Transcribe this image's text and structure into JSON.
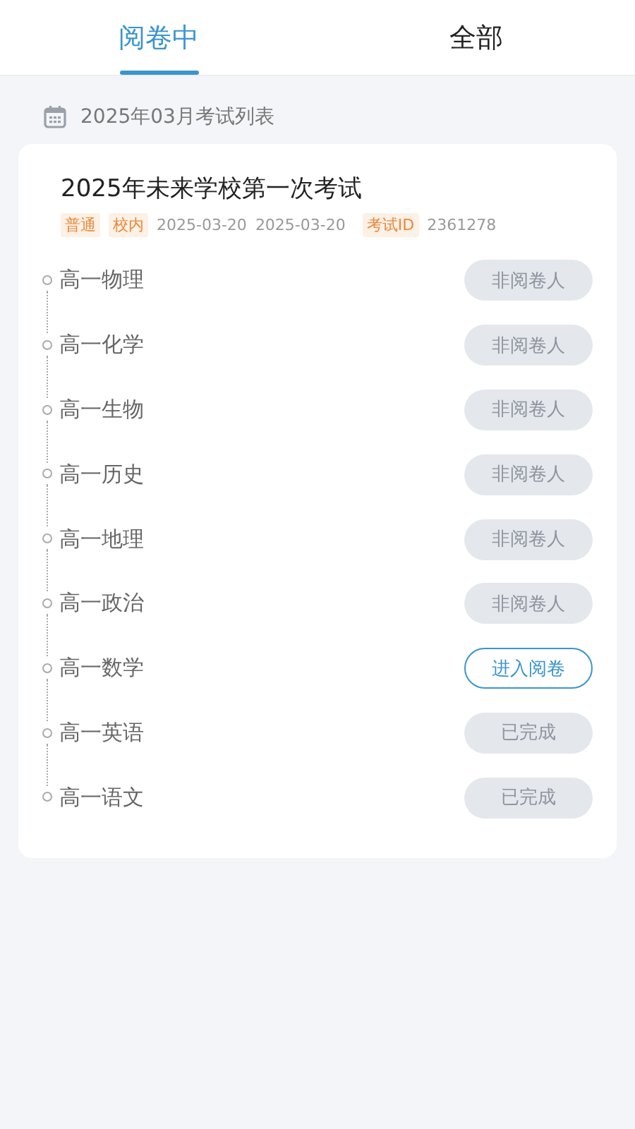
{
  "tabs": [
    {
      "label": "阅卷中",
      "selected": true
    },
    {
      "label": "全部",
      "selected": false
    }
  ],
  "month_header": "2025年03月考试列表",
  "exam": {
    "title": "2025年未来学校第一次考试",
    "tags": [
      "普通",
      "校内"
    ],
    "start_date": "2025-03-20",
    "end_date": "2025-03-20",
    "id_label": "考试ID",
    "id_value": "2361278",
    "subjects": [
      {
        "name": "高一物理",
        "status": "非阅卷人",
        "kind": "muted"
      },
      {
        "name": "高一化学",
        "status": "非阅卷人",
        "kind": "muted"
      },
      {
        "name": "高一生物",
        "status": "非阅卷人",
        "kind": "muted"
      },
      {
        "name": "高一历史",
        "status": "非阅卷人",
        "kind": "muted"
      },
      {
        "name": "高一地理",
        "status": "非阅卷人",
        "kind": "muted"
      },
      {
        "name": "高一政治",
        "status": "非阅卷人",
        "kind": "muted"
      },
      {
        "name": "高一数学",
        "status": "进入阅卷",
        "kind": "action"
      },
      {
        "name": "高一英语",
        "status": "已完成",
        "kind": "muted"
      },
      {
        "name": "高一语文",
        "status": "已完成",
        "kind": "muted"
      }
    ]
  }
}
